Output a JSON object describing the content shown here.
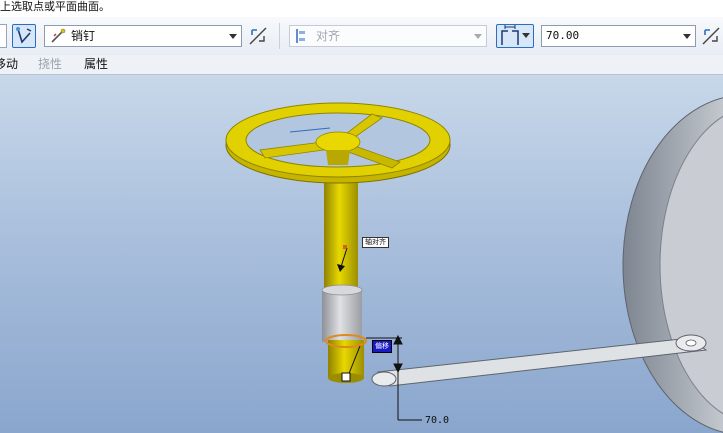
{
  "prompt": {
    "text": "上选取点或平面曲面。"
  },
  "toolbar": {
    "constraint_type": "销钉",
    "align_placeholder": "对齐",
    "offset_value": "70.00",
    "colors": {
      "accent_border": "#2a6fbf",
      "active_bg": "#d7e6f8"
    }
  },
  "tabs": [
    {
      "label": "移动",
      "enabled": true
    },
    {
      "label": "挠性",
      "enabled": false
    },
    {
      "label": "属性",
      "enabled": true
    }
  ],
  "viewport": {
    "labels": {
      "axis_tag": "轴对齐",
      "flag_tag": "偏移",
      "dimension": "70.0"
    },
    "colors": {
      "handwheel": "#d4c200",
      "collar": "#b9bcc0",
      "link": "#d8dcdf",
      "housing": "#c4c9d0",
      "selection": "#e08a1e",
      "flag": "#1919c8"
    }
  }
}
